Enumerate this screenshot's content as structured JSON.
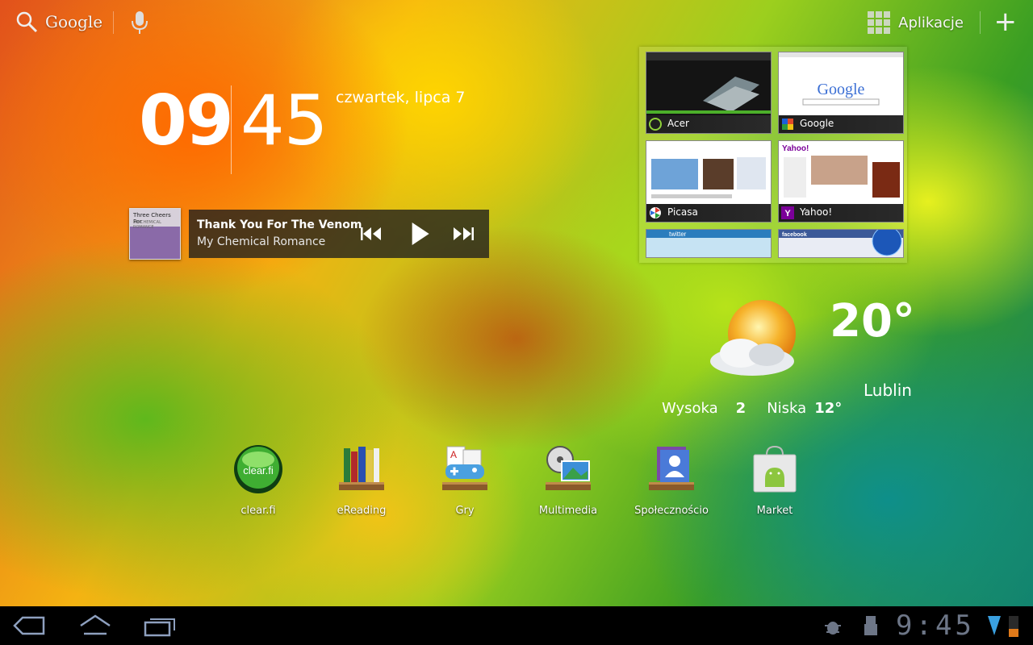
{
  "topbar": {
    "search_label": "Google",
    "apps_label": "Aplikacje",
    "add_label": "+"
  },
  "clock": {
    "hours": "09",
    "minutes": "45",
    "date": "czwartek, lipca 7"
  },
  "music": {
    "album_art_title": "Three Cheers For",
    "album_art_subtitle": "MY CHEMICAL ROMANCE",
    "song": "Thank You For The Venom",
    "artist": "My Chemical Romance"
  },
  "bookmarks": [
    {
      "label": "Acer",
      "icon": "acer-icon"
    },
    {
      "label": "Google",
      "icon": "google-icon"
    },
    {
      "label": "Picasa",
      "icon": "picasa-icon"
    },
    {
      "label": "Yahoo!",
      "icon": "yahoo-icon"
    },
    {
      "label": "",
      "icon": "twitter"
    },
    {
      "label": "",
      "icon": "facebook"
    }
  ],
  "bookmark_shots": {
    "google_logo": "Google",
    "yahoo_logo": "Yahoo!",
    "twitter_logo": "twitter",
    "facebook_logo": "facebook"
  },
  "weather": {
    "temperature": "20°",
    "city": "Lublin",
    "high_label": "Wysoka",
    "high_value": "2",
    "low_label": "Niska",
    "low_value": "12°"
  },
  "dock": [
    {
      "label": "clear.fi"
    },
    {
      "label": "eReading"
    },
    {
      "label": "Gry"
    },
    {
      "label": "Multimedia"
    },
    {
      "label": "Społecznościo"
    },
    {
      "label": "Market"
    }
  ],
  "statusbar": {
    "time": "9:45"
  },
  "colors": {
    "navbar_bg": "#000000",
    "status_icon": "#6d7687",
    "battery": "#e07a1a",
    "signal": "#3aa0e0"
  }
}
